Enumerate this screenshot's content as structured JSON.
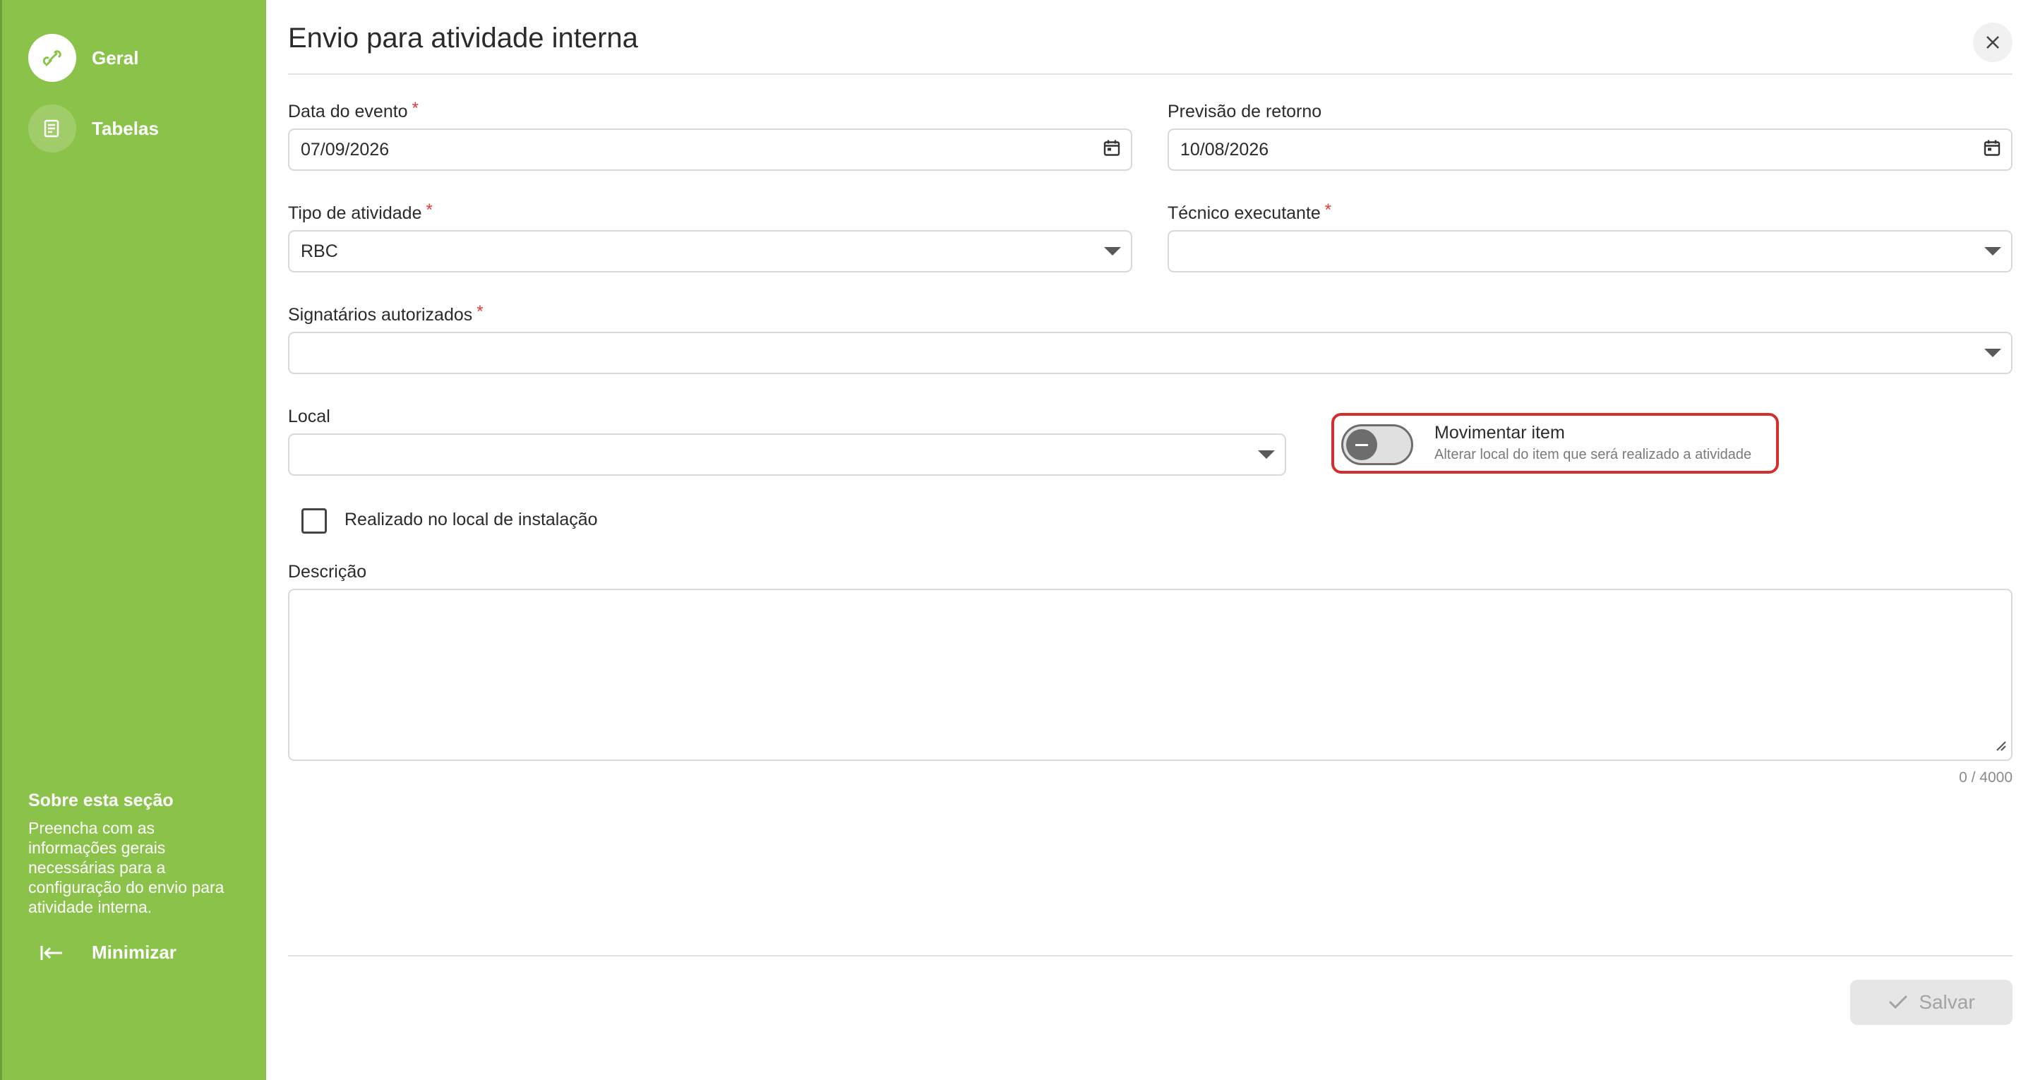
{
  "sidebar": {
    "items": [
      {
        "label": "Geral",
        "icon": "link-icon",
        "active": true
      },
      {
        "label": "Tabelas",
        "icon": "table-icon",
        "active": false
      }
    ],
    "about": {
      "title": "Sobre esta seção",
      "text": "Preencha com as informações gerais necessárias para a configuração do envio para atividade interna."
    },
    "minimize_label": "Minimizar",
    "colors": {
      "background": "#8bc34a"
    }
  },
  "header": {
    "title": "Envio para atividade interna"
  },
  "form": {
    "data_evento": {
      "label": "Data do evento",
      "required_mark": "*",
      "value": "07/09/2026"
    },
    "previsao_retorno": {
      "label": "Previsão de retorno",
      "value": "10/08/2026"
    },
    "tipo_atividade": {
      "label": "Tipo de atividade",
      "required_mark": "*",
      "value": "RBC"
    },
    "tecnico_executante": {
      "label": "Técnico executante",
      "required_mark": "*",
      "value": ""
    },
    "signatarios": {
      "label": "Signatários autorizados",
      "required_mark": "*",
      "value": ""
    },
    "local": {
      "label": "Local",
      "value": ""
    },
    "movimentar": {
      "title": "Movimentar item",
      "subtitle": "Alterar local do item que será realizado a atividade",
      "enabled": false
    },
    "realizado_local": {
      "label": "Realizado no local de instalação",
      "checked": false
    },
    "descricao": {
      "label": "Descrição",
      "value": "",
      "counter": "0 / 4000"
    }
  },
  "footer": {
    "save_label": "Salvar"
  },
  "colors": {
    "highlight": "#d32f2f",
    "required": "#e53935"
  }
}
